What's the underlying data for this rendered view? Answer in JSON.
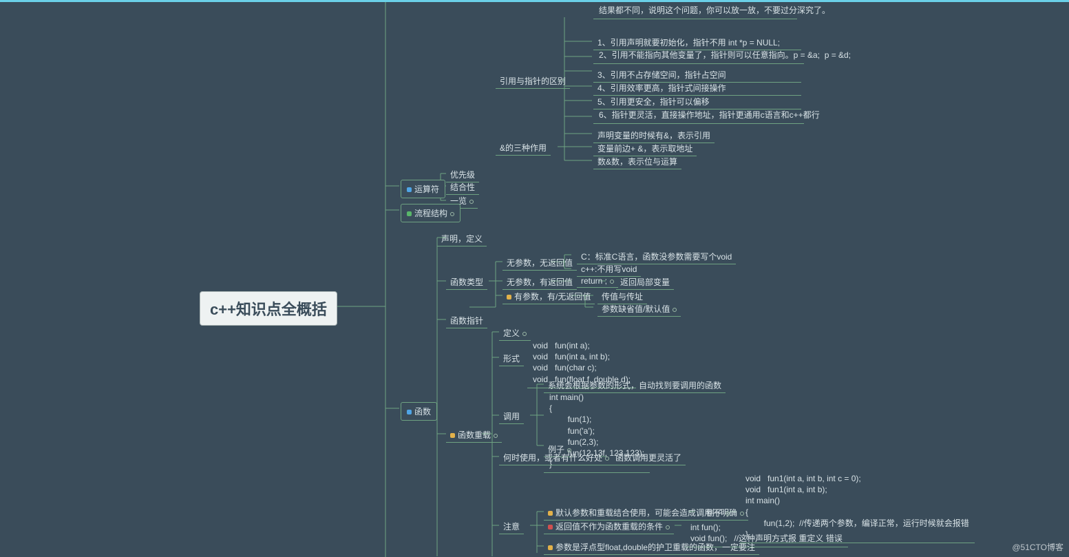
{
  "root": "c++知识点全概括",
  "n_prev": "结果都不同，说明这个问题，你可以放一放，不要过分深究了。",
  "ref_ptr_title": "引用与指针的区别",
  "ref_ptr": [
    "1、引用声明就要初始化，指针不用  int *p = NULL;",
    "2、引用不能指向其他变量了，指针则可以任意指向。p = &a;  p = &d;",
    "3、引用不占存储空间，指针占空间",
    "4、引用效率更高，指针式间接操作",
    "5、引用更安全，指针可以偏移",
    "6、指针更灵活，直接操作地址，指针更通用c语言和c++都行"
  ],
  "amp_title": "&的三种作用",
  "amp": [
    "声明变量的时候有&，表示引用",
    "变量前边+ &，表示取地址",
    "数&数，表示位与运算"
  ],
  "op_title": "运算符",
  "op": [
    "优先级",
    "结合性",
    "一览"
  ],
  "flow_title": "流程结构",
  "func_title": "函数",
  "func_decl": "声明，定义",
  "func_type_title": "函数类型",
  "ft_noarg_noret": "无参数，无返回值",
  "ft_noarg_noret_c": [
    "C：标准C语言，函数没参数需要写个void",
    "c++:不用写void"
  ],
  "ft_noarg_ret": "无参数，有返回值",
  "ft_return": "return ;",
  "ft_retlocal": "返回局部变量",
  "ft_hasarg": "有参数，有/无返回值",
  "ft_hasarg_c": [
    "传值与传址",
    "参数缺省值/默认值"
  ],
  "func_ptr": "函数指针",
  "overload_title": "函数重载",
  "ov_def": "定义",
  "ov_form": "形式",
  "ov_form_code": "void   fun(int a);\nvoid   fun(int a, int b);\nvoid   fun(char c);\nvoid   fun(float f, double d);",
  "ov_call": "调用",
  "ov_call_sys": "系统会根据参数的形式，自动找到要调用的函数",
  "ov_call_ex": "例子",
  "ov_call_code": "int main()\n{\n        fun(1);\n        fun('a');\n        fun(2,3);\n        fun(12.13f, 123.123);\n}",
  "ov_when": "何时使用，或者有什么好处",
  "ov_when_ans": "函数调用更灵活了",
  "ov_note": "注意",
  "ov_note_1": "默认参数和重载结合使用，可能会造成调用不明确",
  "ov_note_1_ex": "例子",
  "ov_note_1_code": "void   fun1(int a, int b, int c = 0);\nvoid   fun1(int a, int b);\nint main()\n{\n        fun(1,2);  //传递两个参数，编译正常，运行时候就会报错\n}",
  "ov_note_2": "返回值不作为函数重载的条件",
  "ov_note_2_code": "int fun();\nvoid fun();   //这种声明方式报 重定义 错误",
  "ov_note_3": "参数是浮点型float,double的护卫重载的函数，一定要注",
  "wm": "@51CTO博客"
}
